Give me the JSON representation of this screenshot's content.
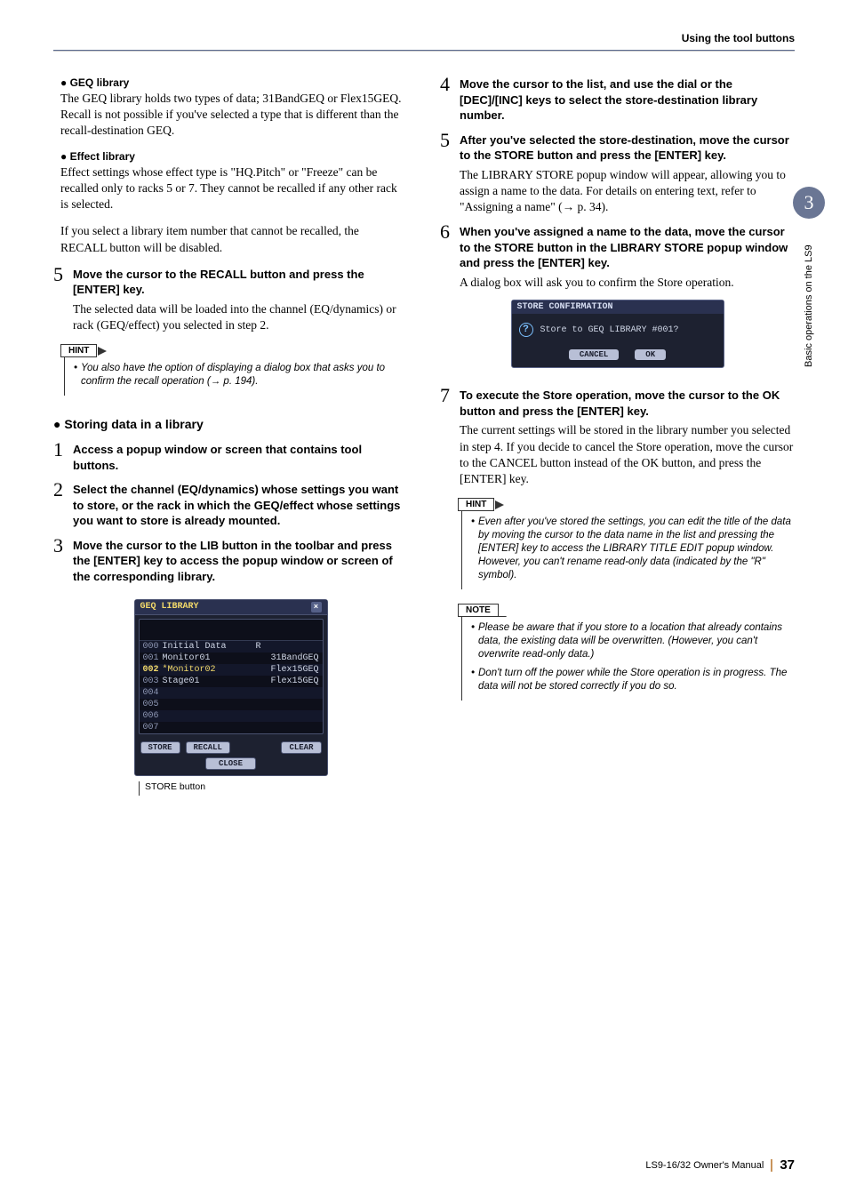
{
  "header": {
    "section": "Using the tool buttons"
  },
  "sideTab": {
    "chapter": "3",
    "label": "Basic operations on the LS9"
  },
  "left": {
    "geqHead": "GEQ library",
    "geqPara": "The GEQ library holds two types of data; 31BandGEQ or Flex15GEQ. Recall is not possible if you've selected a type that is different than the recall-destination GEQ.",
    "effHead": "Effect library",
    "effPara1": "Effect settings whose effect type is \"HQ.Pitch\" or \"Freeze\" can be recalled only to racks 5 or 7. They cannot be recalled if any other rack is selected.",
    "effPara2": "If you select a library item number that cannot be recalled, the RECALL button will be disabled.",
    "step5": {
      "num": "5",
      "bold": "Move the cursor to the RECALL button and press the [ENTER] key.",
      "text": "The selected data will be loaded into the channel (EQ/dynamics) or rack (GEQ/effect) you selected in step 2."
    },
    "hint1Label": "HINT",
    "hint1": "You also have the option of displaying a dialog box that asks you to confirm the recall operation (→ p. 194).",
    "storingHead": "Storing data in a library",
    "s1": {
      "num": "1",
      "bold": "Access a popup window or screen that contains tool buttons."
    },
    "s2": {
      "num": "2",
      "bold": "Select the channel (EQ/dynamics) whose settings you want to store, or the rack in which the GEQ/effect whose settings you want to store is already mounted."
    },
    "s3": {
      "num": "3",
      "bold": "Move the cursor to the LIB button in the toolbar and press the [ENTER] key to access the  popup window or screen of the corresponding library."
    },
    "geqWin": {
      "title": "GEQ LIBRARY",
      "rows": [
        {
          "idx": "000",
          "name": "Initial Data",
          "flag": "R",
          "type": "",
          "sel": false,
          "bg": true
        },
        {
          "idx": "001",
          "name": "Monitor01",
          "flag": "",
          "type": "31BandGEQ",
          "sel": false,
          "bg": false
        },
        {
          "idx": "002",
          "name": "*Monitor02",
          "flag": "",
          "type": "Flex15GEQ",
          "sel": true,
          "bg": true
        },
        {
          "idx": "003",
          "name": "Stage01",
          "flag": "",
          "type": "Flex15GEQ",
          "sel": false,
          "bg": false
        },
        {
          "idx": "004",
          "name": "",
          "flag": "",
          "type": "",
          "sel": false,
          "bg": true
        },
        {
          "idx": "005",
          "name": "",
          "flag": "",
          "type": "",
          "sel": false,
          "bg": false
        },
        {
          "idx": "006",
          "name": "",
          "flag": "",
          "type": "",
          "sel": false,
          "bg": true
        },
        {
          "idx": "007",
          "name": "",
          "flag": "",
          "type": "",
          "sel": false,
          "bg": false
        }
      ],
      "btns": {
        "store": "STORE",
        "recall": "RECALL",
        "clear": "CLEAR",
        "close": "CLOSE"
      }
    },
    "figCaption": "STORE button"
  },
  "right": {
    "s4": {
      "num": "4",
      "bold": "Move the cursor to the list, and use the dial or the [DEC]/[INC] keys to select the store-destination library number."
    },
    "s5": {
      "num": "5",
      "bold": "After you've selected the store-destination, move the cursor to the STORE button and press the [ENTER] key.",
      "text": "The LIBRARY STORE popup window will appear, allowing you to assign a name to the data. For details on entering text, refer to \"Assigning a name\" (→ p. 34)."
    },
    "s6": {
      "num": "6",
      "bold": "When you've assigned a name to the data, move the cursor to the STORE button in the LIBRARY STORE popup window and press the [ENTER] key.",
      "text": "A dialog box will ask you to confirm the Store operation."
    },
    "storePopup": {
      "title": "STORE CONFIRMATION",
      "msg": "Store to GEQ LIBRARY #001?",
      "cancel": "CANCEL",
      "ok": "OK"
    },
    "s7": {
      "num": "7",
      "bold": "To execute the Store operation, move the cursor to the OK button and press the [ENTER] key.",
      "text": "The current settings will be stored in the library number you selected in step 4. If you decide to cancel the Store operation, move the cursor to the CANCEL button instead of the OK button, and press the [ENTER] key."
    },
    "hint2Label": "HINT",
    "hint2": "Even after you've stored the settings, you can edit the title of the data by moving the cursor to the data name in the list and pressing the [ENTER] key to access the LIBRARY TITLE EDIT popup window. However, you can't rename read-only data (indicated by the \"R\" symbol).",
    "noteLabel": "NOTE",
    "note1": "Please be aware that if you store to a location that already contains data, the existing data will be overwritten. (However, you can't overwrite read-only data.)",
    "note2": "Don't turn off the power while the Store operation is in progress. The data will not be stored correctly if you do so."
  },
  "footer": {
    "manual": "LS9-16/32  Owner's Manual",
    "page": "37"
  }
}
